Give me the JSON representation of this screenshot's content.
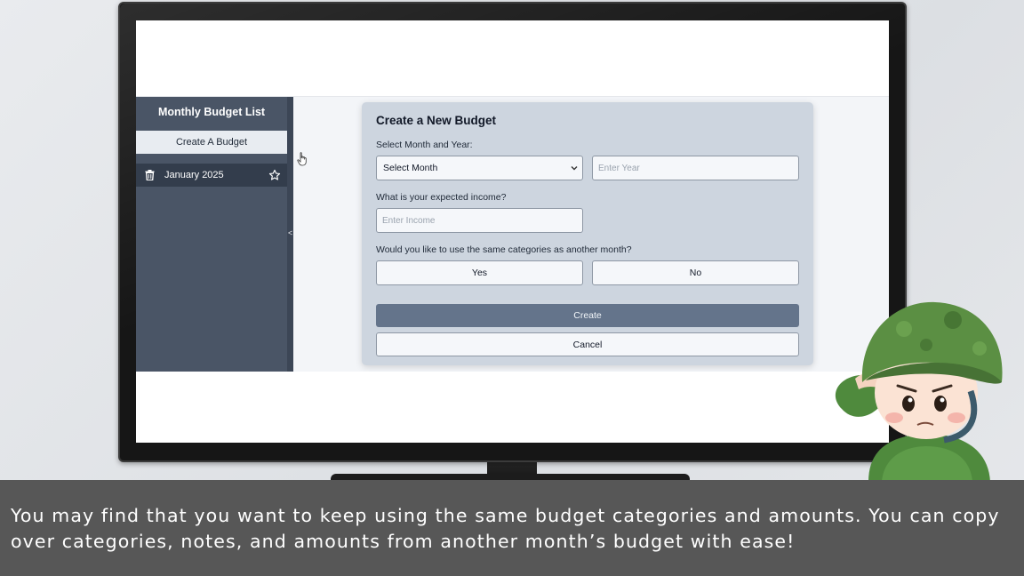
{
  "sidebar": {
    "title": "Monthly Budget List",
    "create_button": "Create A Budget",
    "items": [
      {
        "label": "January 2025"
      }
    ],
    "collapse_arrow": "<"
  },
  "modal": {
    "title": "Create a New Budget",
    "month_year_label": "Select Month and Year:",
    "month_select_value": "Select Month",
    "year_placeholder": "Enter Year",
    "income_label": "What is your expected income?",
    "income_placeholder": "Enter Income",
    "same_categories_label": "Would you like to use the same categories as another month?",
    "yes_label": "Yes",
    "no_label": "No",
    "create_label": "Create",
    "cancel_label": "Cancel"
  },
  "caption": {
    "text": "You may find that you want to keep using the same budget categories and amounts. You can copy over categories, notes, and amounts from another month’s budget with ease!"
  },
  "colors": {
    "sidebar_bg": "#4a5566",
    "create_button_bg": "#64748b",
    "modal_bg": "#cdd5df",
    "caption_bg": "#575757"
  },
  "icons": {
    "trash": "trash-icon",
    "star": "star-icon",
    "cursor": "hand-cursor-icon",
    "chevron": "chevron-down-icon"
  }
}
